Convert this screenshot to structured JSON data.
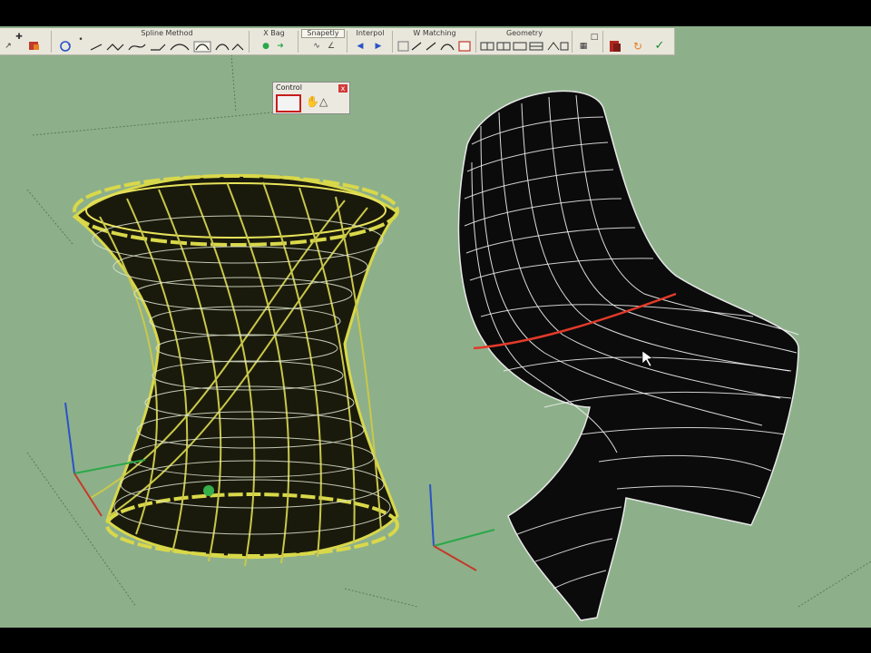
{
  "toolbar": {
    "groups": [
      {
        "label": "Spline Method"
      },
      {
        "label": "X Bag"
      },
      {
        "label": "Snapetly"
      },
      {
        "label": "Interpol"
      },
      {
        "label": "W Matching"
      },
      {
        "label": "Geometry"
      }
    ],
    "icons": [
      "pointer-icon",
      "paint-bucket-icon",
      "rotate-icon",
      "spline-icon",
      "bend-icon",
      "curve-icon",
      "grid-icon",
      "box-icon",
      "confirm-check-icon"
    ]
  },
  "panel": {
    "title": "Control",
    "close": "x"
  },
  "viewport": {
    "background": "#8db08a",
    "stool_color": "#d9d84a",
    "mesh_color": "#0b0b0b",
    "wire_color": "#f2f2f2",
    "highlight_color": "#e23a2a",
    "axis_x": "#c33a2a",
    "axis_y": "#2aa84a",
    "axis_z": "#2a52c8"
  }
}
